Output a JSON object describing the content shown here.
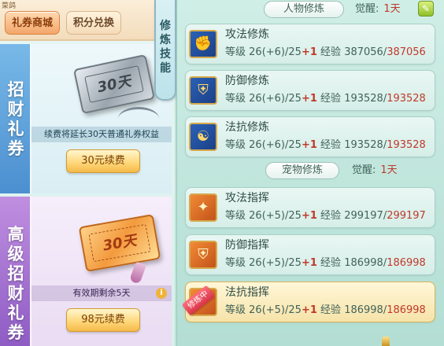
{
  "corner_label": "菜鸽",
  "tabs": [
    {
      "label": "礼券商城"
    },
    {
      "label": "积分兑换"
    }
  ],
  "card1": {
    "title": "招财礼券",
    "ticket_text": "30天",
    "note": "续费将延长30天普通礼券权益",
    "button": "30元续费"
  },
  "card2": {
    "title": "高级招财礼券",
    "ticket_text": "30天",
    "note": "有效期剩余5天",
    "info_icon": "i",
    "button": "98元续费"
  },
  "ribbon": {
    "text": "修炼技能"
  },
  "character_section": {
    "title": "人物修炼",
    "awaken_label": "觉醒:",
    "awaken_value": "1天",
    "skills": [
      {
        "name": "攻法修炼",
        "icon": "fist-icon",
        "level_label": "等级",
        "level": "26(+6)/25",
        "plus": "+1",
        "exp_label": "经验",
        "exp": "387056/",
        "exp_max": "387056"
      },
      {
        "name": "防御修炼",
        "icon": "shield-icon",
        "level_label": "等级",
        "level": "26(+6)/25",
        "plus": "+1",
        "exp_label": "经验",
        "exp": "193528/",
        "exp_max": "193528"
      },
      {
        "name": "法抗修炼",
        "icon": "taiji-icon",
        "level_label": "等级",
        "level": "26(+6)/25",
        "plus": "+1",
        "exp_label": "经验",
        "exp": "193528/",
        "exp_max": "193528"
      }
    ]
  },
  "pet_section": {
    "title": "宠物修炼",
    "awaken_label": "觉醒:",
    "awaken_value": "1天",
    "skills": [
      {
        "name": "攻法指挥",
        "icon": "paw-attack-icon",
        "level_label": "等级",
        "level": "26(+5)/25",
        "plus": "+1",
        "exp_label": "经验",
        "exp": "299197/",
        "exp_max": "299197"
      },
      {
        "name": "防御指挥",
        "icon": "paw-shield-icon",
        "level_label": "等级",
        "level": "26(+5)/25",
        "plus": "+1",
        "exp_label": "经验",
        "exp": "186998/",
        "exp_max": "186998"
      },
      {
        "name": "法抗指挥",
        "icon": "paw-resist-icon",
        "level_label": "等级",
        "level": "26(+5)/25",
        "plus": "+1",
        "exp_label": "经验",
        "exp": "186998/",
        "exp_max": "186998",
        "badge": "修炼中"
      }
    ]
  },
  "colors": {
    "accent_red": "#c0392b",
    "panel_green": "#cfeee6",
    "gold_button": "#ffd97d"
  }
}
